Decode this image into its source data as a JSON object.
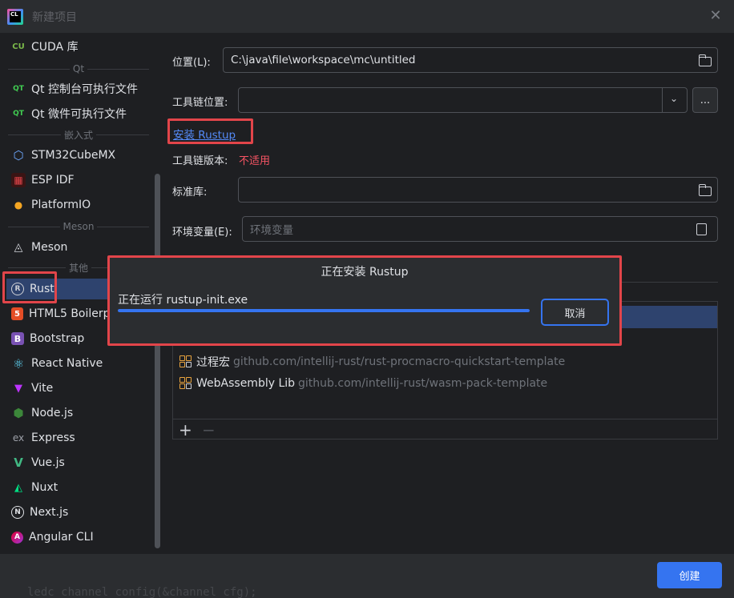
{
  "window": {
    "title": "新建项目",
    "logo_text": "CL"
  },
  "sidebar": {
    "items": [
      {
        "label": "CUDA 库",
        "icon": "cuda-icon",
        "glyph": "CU"
      },
      {
        "label": "Qt 控制台可执行文件",
        "icon": "qt-icon",
        "glyph": "QT"
      },
      {
        "label": "Qt 微件可执行文件",
        "icon": "qt-icon",
        "glyph": "QT"
      },
      {
        "label": "STM32CubeMX",
        "icon": "cube-icon",
        "glyph": "⬡"
      },
      {
        "label": "ESP IDF",
        "icon": "esp-icon",
        "glyph": "▦"
      },
      {
        "label": "PlatformIO",
        "icon": "platformio-icon",
        "glyph": "👽"
      },
      {
        "label": "Meson",
        "icon": "meson-icon",
        "glyph": "◬"
      },
      {
        "label": "Rust",
        "icon": "rust-icon",
        "glyph": "R"
      },
      {
        "label": "HTML5 Boilerp",
        "icon": "html5-icon",
        "glyph": "5"
      },
      {
        "label": "Bootstrap",
        "icon": "bootstrap-icon",
        "glyph": "B"
      },
      {
        "label": "React Native",
        "icon": "react-icon",
        "glyph": "⚛"
      },
      {
        "label": "Vite",
        "icon": "vite-icon",
        "glyph": "▼"
      },
      {
        "label": "Node.js",
        "icon": "nodejs-icon",
        "glyph": "⬢"
      },
      {
        "label": "Express",
        "icon": "express-icon",
        "glyph": "ex"
      },
      {
        "label": "Vue.js",
        "icon": "vue-icon",
        "glyph": "V"
      },
      {
        "label": "Nuxt",
        "icon": "nuxt-icon",
        "glyph": "◭"
      },
      {
        "label": "Next.js",
        "icon": "nextjs-icon",
        "glyph": "N"
      },
      {
        "label": "Angular CLI",
        "icon": "angular-icon",
        "glyph": "A"
      }
    ],
    "groups": {
      "qt": "Qt",
      "embedded": "嵌入式",
      "meson": "Meson",
      "other": "其他"
    }
  },
  "form": {
    "location_label": "位置(L):",
    "location_value": "C:\\java\\file\\workspace\\mc\\untitled",
    "toolchain_label": "工具链位置:",
    "toolchain_value": "",
    "browse_label": "...",
    "install_rustup_link": "安装 Rustup",
    "toolchain_version_label": "工具链版本:",
    "toolchain_version_value": "不适用",
    "stdlib_label": "标准库:",
    "stdlib_value": "",
    "env_label": "环境变量(E):",
    "env_placeholder": "环境变量"
  },
  "templates": [
    {
      "name": "过程宏",
      "url": "github.com/intellij-rust/rust-procmacro-quickstart-template"
    },
    {
      "name": "WebAssembly Lib",
      "url": "github.com/intellij-rust/wasm-pack-template"
    }
  ],
  "template_toolbar": {
    "add": "+",
    "remove": "−"
  },
  "modal": {
    "title": "正在安装 Rustup",
    "status": "正在运行 rustup-init.exe",
    "progress": 1.0,
    "cancel_label": "取消"
  },
  "footer": {
    "background_code": "ledc_channel_config(&channel_cfg);",
    "create_label": "创建"
  },
  "colors": {
    "accent": "#3574f0",
    "highlight": "#e2454a",
    "error": "#f75464",
    "link": "#548af7"
  }
}
